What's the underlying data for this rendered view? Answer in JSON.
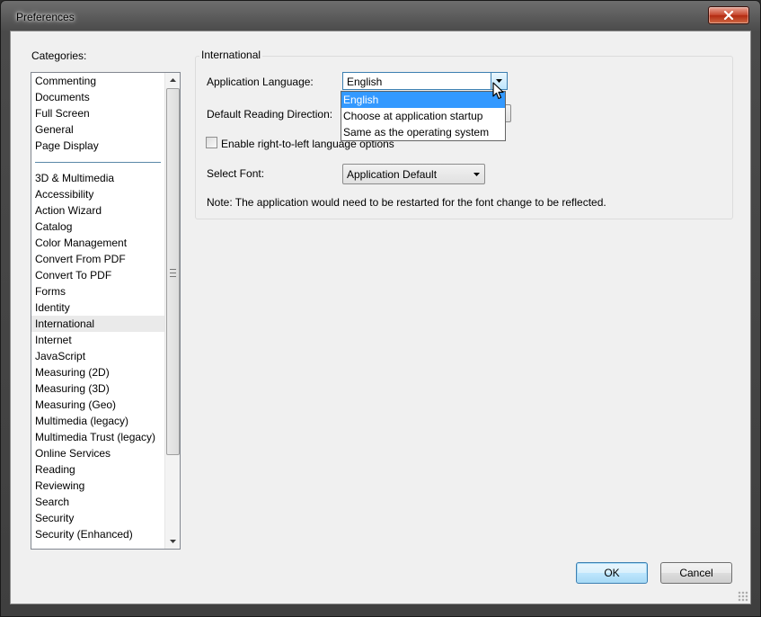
{
  "window": {
    "title": "Preferences"
  },
  "categories": {
    "label": "Categories:",
    "items": [
      {
        "label": "Commenting"
      },
      {
        "label": "Documents"
      },
      {
        "label": "Full Screen"
      },
      {
        "label": "General"
      },
      {
        "label": "Page Display"
      },
      {
        "label": "",
        "separator": true
      },
      {
        "label": "3D & Multimedia"
      },
      {
        "label": "Accessibility"
      },
      {
        "label": "Action Wizard"
      },
      {
        "label": "Catalog"
      },
      {
        "label": "Color Management"
      },
      {
        "label": "Convert From PDF"
      },
      {
        "label": "Convert To PDF"
      },
      {
        "label": "Forms"
      },
      {
        "label": "Identity"
      },
      {
        "label": "International",
        "selected": true
      },
      {
        "label": "Internet"
      },
      {
        "label": "JavaScript"
      },
      {
        "label": "Measuring (2D)"
      },
      {
        "label": "Measuring (3D)"
      },
      {
        "label": "Measuring (Geo)"
      },
      {
        "label": "Multimedia (legacy)"
      },
      {
        "label": "Multimedia Trust (legacy)"
      },
      {
        "label": "Online Services"
      },
      {
        "label": "Reading"
      },
      {
        "label": "Reviewing"
      },
      {
        "label": "Search"
      },
      {
        "label": "Security"
      },
      {
        "label": "Security (Enhanced)"
      }
    ]
  },
  "international": {
    "group_title": "International",
    "app_language_label": "Application Language:",
    "app_language_value": "English",
    "app_language_options": [
      "English",
      "Choose at application startup",
      "Same as the operating system"
    ],
    "highlighted_option": "English",
    "reading_direction_label": "Default Reading Direction:",
    "rtl_checkbox_label": "Enable right-to-left language options",
    "rtl_checked": false,
    "select_font_label": "Select Font:",
    "select_font_value": "Application Default",
    "note": "Note: The application would need to be restarted for the font change to be reflected."
  },
  "buttons": {
    "ok": "OK",
    "cancel": "Cancel"
  },
  "icons": {
    "close": "close-icon",
    "scroll_up": "arrow-up-icon",
    "scroll_down": "arrow-down-icon",
    "dropdown": "chevron-down-icon",
    "cursor": "mouse-pointer-icon"
  },
  "colors": {
    "highlight": "#3399ff",
    "close_button": "#c8472f",
    "focus_border": "#3c7fb1"
  }
}
